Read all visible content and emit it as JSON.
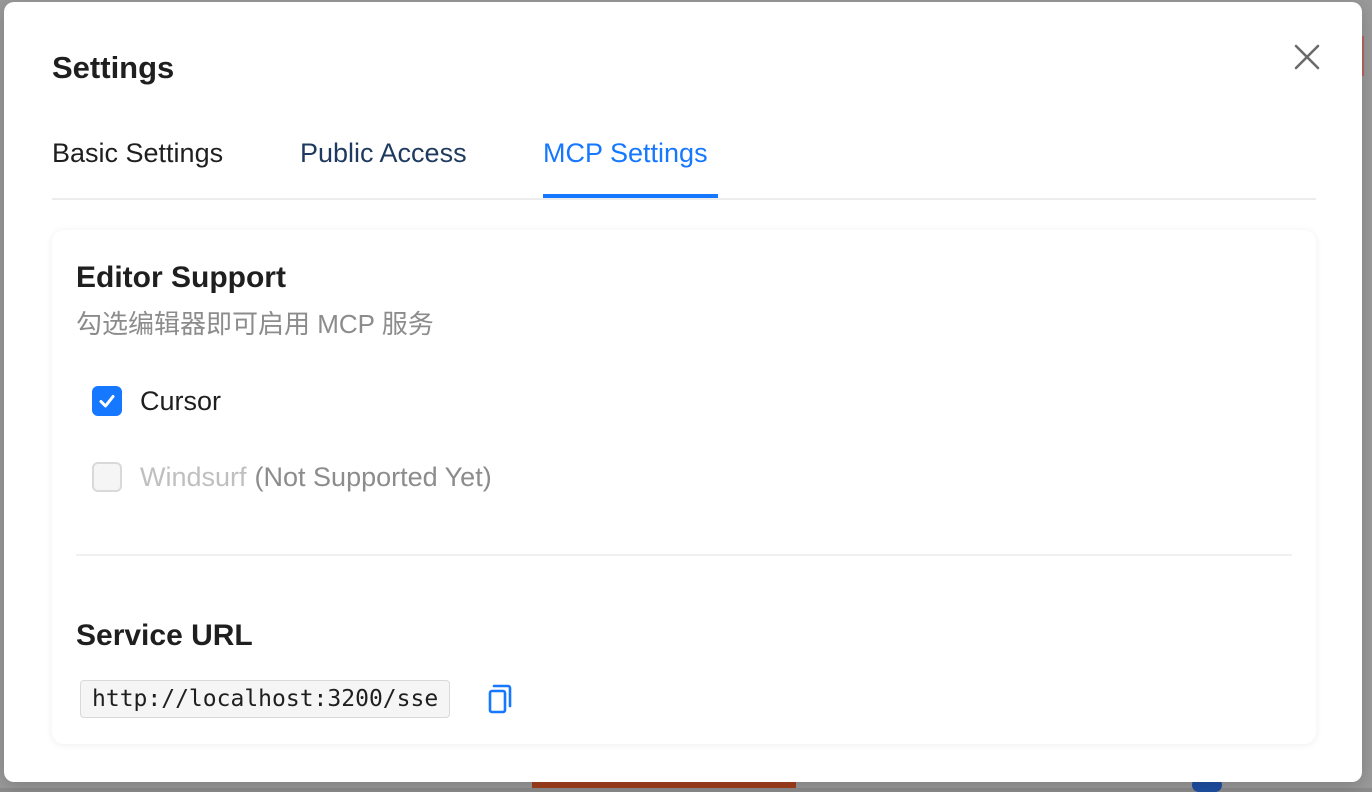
{
  "dialog": {
    "title": "Settings"
  },
  "tabs": [
    {
      "label": "Basic Settings"
    },
    {
      "label": "Public Access"
    },
    {
      "label": "MCP Settings"
    }
  ],
  "active_tab": "MCP Settings",
  "colors": {
    "accent": "#1677ff",
    "muted_text": "#8c8c8c",
    "disabled_text": "#bfbfbf"
  },
  "editor_support": {
    "title": "Editor Support",
    "description": "勾选编辑器即可启用 MCP 服务",
    "options": [
      {
        "label": "Cursor",
        "checked": true,
        "disabled": false,
        "note": ""
      },
      {
        "label": "Windsurf",
        "checked": false,
        "disabled": true,
        "note": "(Not Supported Yet)"
      }
    ]
  },
  "service_url": {
    "title": "Service URL",
    "value": "http://localhost:3200/sse",
    "copy_icon": "copy-icon"
  },
  "icons": {
    "close": "close-icon",
    "check": "checkmark-icon",
    "copy": "copy-icon"
  }
}
